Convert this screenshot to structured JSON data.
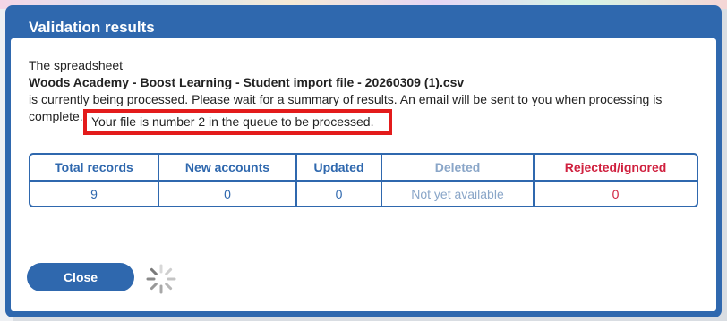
{
  "dialog": {
    "title": "Validation results",
    "intro": "The spreadsheet",
    "filename": "Woods Academy - Boost Learning - Student import file - 20260309 (1).csv",
    "processing_line1": "is currently being processed. Please wait for a summary of results. An email will be sent to you when processing is",
    "processing_line2": "complete.",
    "queue_message": "Your file is number 2 in the queue to be processed."
  },
  "results": {
    "headers": [
      "Total records",
      "New accounts",
      "Updated",
      "Deleted",
      "Rejected/ignored"
    ],
    "values": [
      "9",
      "0",
      "0",
      "Not yet available",
      "0"
    ]
  },
  "actions": {
    "close_label": "Close"
  },
  "colors": {
    "primary": "#2f68ae",
    "highlight_border": "#e31b1b",
    "rejected": "#d0213f",
    "deleted_muted": "#8aa6c8"
  },
  "icons": {
    "loading": "loading-spinner-icon"
  }
}
